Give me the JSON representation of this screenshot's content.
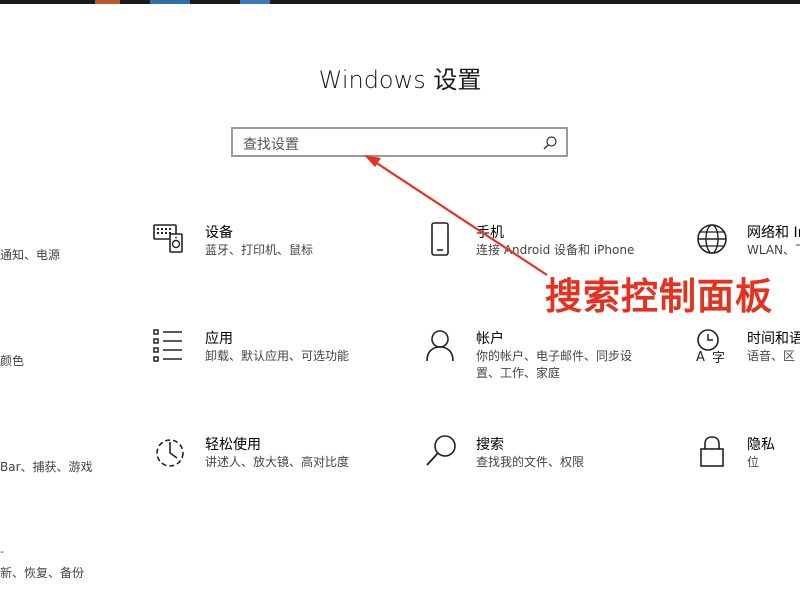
{
  "window": {
    "title": "Windows 设置"
  },
  "search": {
    "placeholder": "查找设置"
  },
  "tiles": [
    {
      "name": "设备",
      "desc": "蓝牙、打印机、鼠标",
      "icon": "devices-icon"
    },
    {
      "name": "手机",
      "desc": "连接 Android 设备和 iPhone",
      "icon": "phone-icon"
    },
    {
      "name": "网络和 In",
      "desc": "WLAN、飞行",
      "icon": "network-globe-icon"
    },
    {
      "name": "应用",
      "desc": "卸载、默认应用、可选功能",
      "icon": "apps-list-icon"
    },
    {
      "name": "帐户",
      "desc": "你的帐户、电子邮件、同步设置、工作、家庭",
      "icon": "account-person-icon"
    },
    {
      "name": "时间和语",
      "desc": "语音、区",
      "icon": "time-language-icon"
    },
    {
      "name": "轻松使用",
      "desc": "讲述人、放大镜、高对比度",
      "icon": "ease-of-access-icon"
    },
    {
      "name": "搜索",
      "desc": "查找我的文件、权限",
      "icon": "search-magnifier-icon"
    },
    {
      "name": "隐私",
      "desc": "位",
      "icon": "privacy-lock-icon"
    }
  ],
  "partial_left": {
    "row1": "通知、电源",
    "row2": "颜色",
    "row3": "Bar、捕获、游戏",
    "row4": "新、恢复、备份"
  },
  "annotation": {
    "text": "搜索控制面板",
    "color": "#e5311f"
  }
}
